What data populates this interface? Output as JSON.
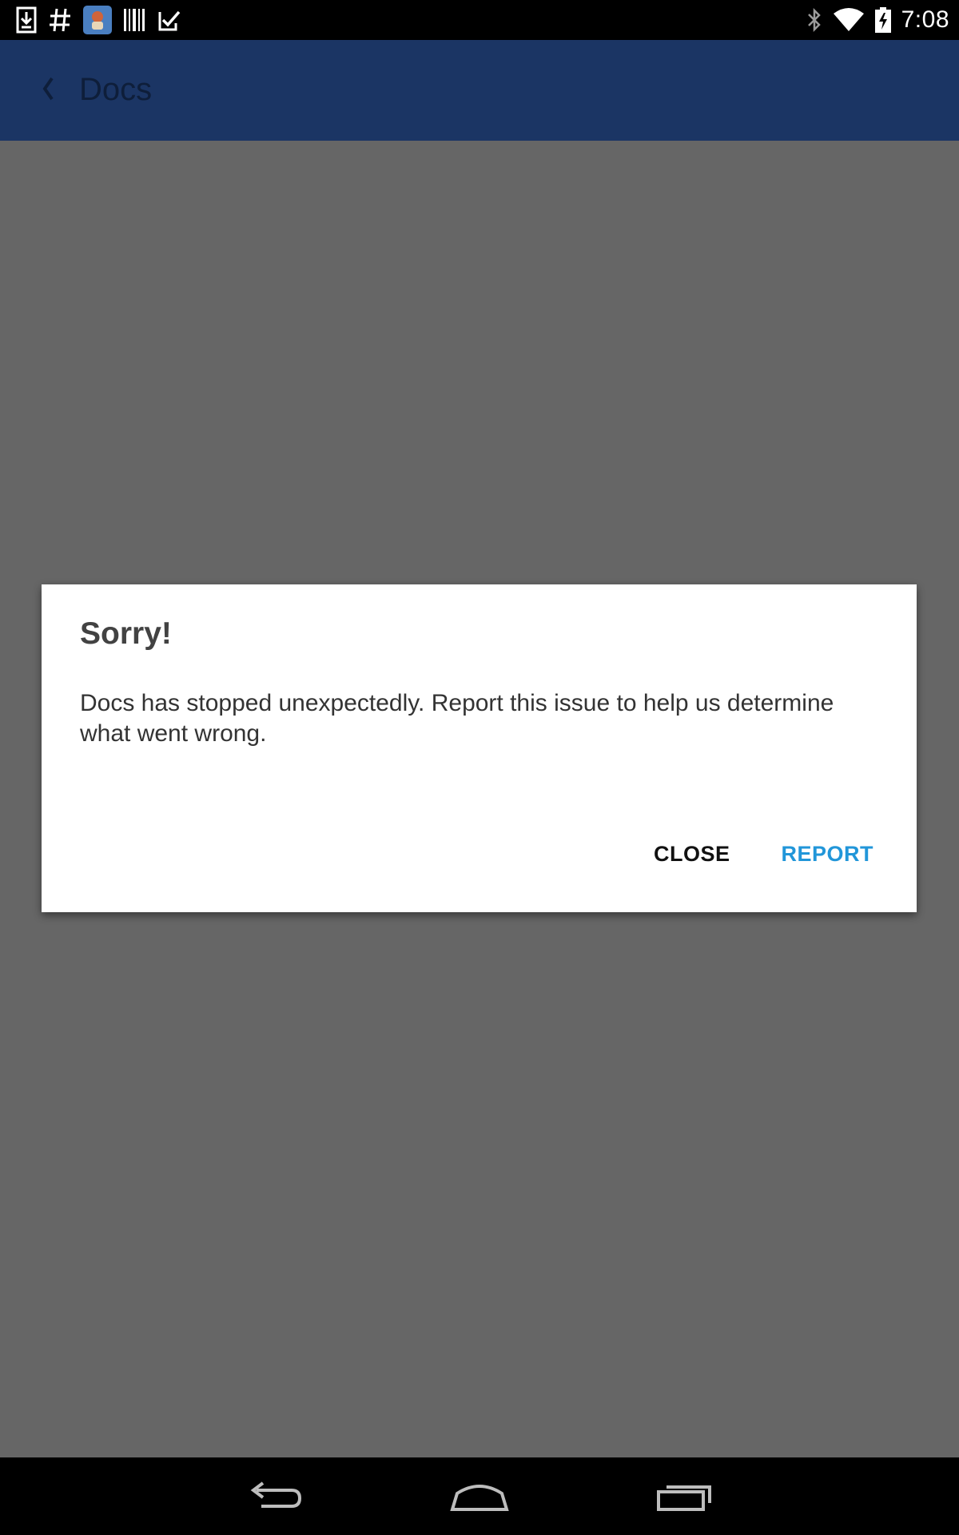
{
  "status_bar": {
    "left_icons": [
      "download-notification-icon",
      "hashtag-icon",
      "app-notification-icon",
      "barcode-icon",
      "task-check-icon"
    ],
    "right_icons": [
      "bluetooth-icon",
      "wifi-icon",
      "battery-charging-icon"
    ],
    "time": "7:08"
  },
  "app_bar": {
    "back_icon": "chevron-left-icon",
    "title": "Docs",
    "color": "#1b3564"
  },
  "dialog": {
    "title": "Sorry!",
    "message": "Docs has stopped unexpectedly. Report this issue to help us determine what went wrong.",
    "close_label": "CLOSE",
    "report_label": "REPORT",
    "accent_color": "#2196d9"
  },
  "nav_bar": {
    "buttons": [
      "back-icon",
      "home-icon",
      "recents-icon"
    ]
  }
}
